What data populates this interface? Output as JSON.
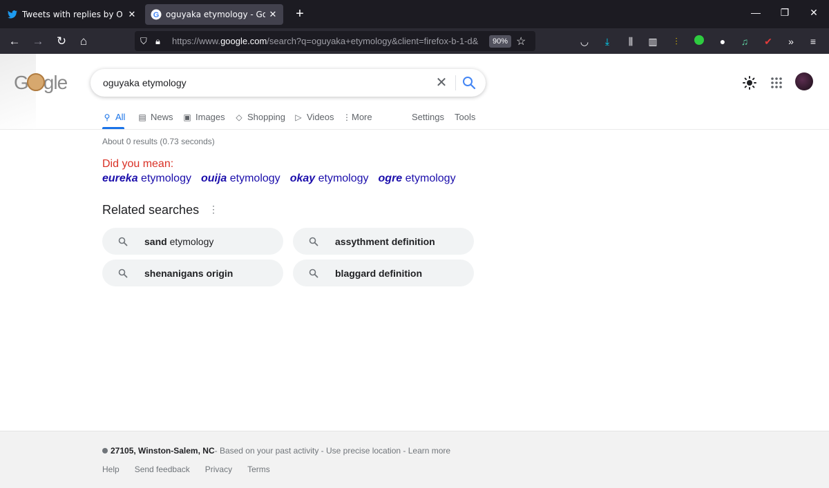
{
  "browser": {
    "tabs": [
      {
        "title": "Tweets with replies by O G R E"
      },
      {
        "title": "oguyaka etymology - Google Search"
      }
    ],
    "url_prefix": "https://www.",
    "url_domain": "google.com",
    "url_suffix": "/search?q=oguyaka+etymology&client=firefox-b-1-d&",
    "zoom": "90%"
  },
  "search": {
    "query": "oguyaka etymology",
    "logo_text": "Google"
  },
  "tabs": {
    "all": "All",
    "news": "News",
    "images": "Images",
    "shopping": "Shopping",
    "videos": "Videos",
    "more": "More",
    "settings": "Settings",
    "tools": "Tools"
  },
  "results": {
    "stats": "About 0 results (0.73 seconds)",
    "did_you_mean": "Did you mean:",
    "suggestions": [
      {
        "bold": "eureka",
        "rest": " etymology"
      },
      {
        "bold": "ouija",
        "rest": " etymology"
      },
      {
        "bold": "okay",
        "rest": " etymology"
      },
      {
        "bold": "ogre",
        "rest": " etymology"
      }
    ]
  },
  "related": {
    "title": "Related searches",
    "chips": [
      {
        "bold": "sand",
        "rest": " etymology"
      },
      {
        "bold": "assythment definition",
        "rest": ""
      },
      {
        "bold": "shenanigans origin",
        "rest": ""
      },
      {
        "bold": "blaggard definition",
        "rest": ""
      }
    ]
  },
  "footer": {
    "location": "27105, Winston-Salem, NC",
    "loc_rest": " - Based on your past activity - Use precise location - Learn more",
    "links": [
      "Help",
      "Send feedback",
      "Privacy",
      "Terms"
    ]
  },
  "colors": {
    "link": "#1a0dab",
    "accent": "#1a73e8",
    "did_you_mean": "#d93025",
    "chrome_dark": "#1c1b22"
  }
}
